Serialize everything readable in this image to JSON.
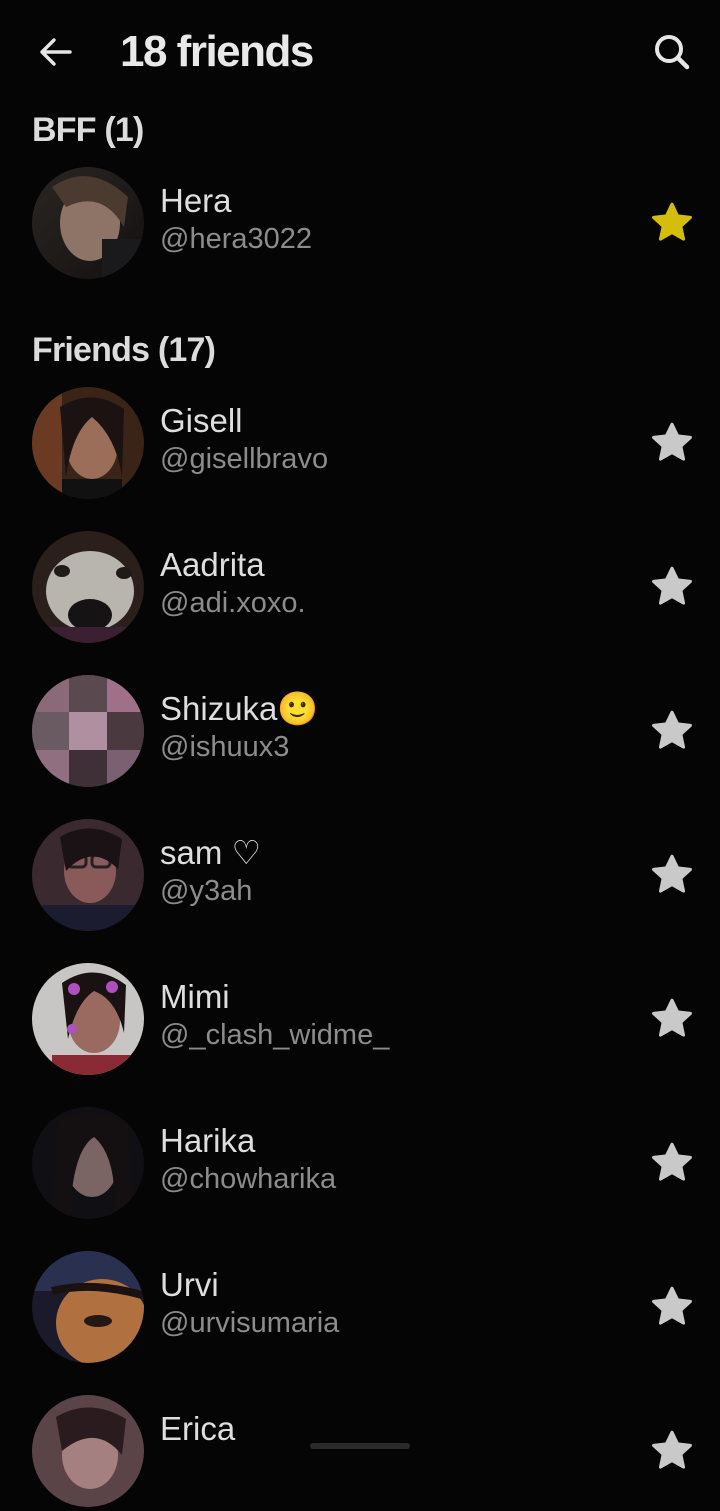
{
  "header": {
    "back_icon": "arrow-left-icon",
    "title": "18 friends",
    "search_icon": "search-icon"
  },
  "colors": {
    "background": "#050505",
    "star_active": "#d4bd0c",
    "star_inactive": "#c9c9c9",
    "text_primary": "#dedede",
    "text_secondary": "#8c8c8c"
  },
  "bff": {
    "title": "BFF (1)",
    "items": [
      {
        "name": "Hera",
        "handle": "@hera3022",
        "starred": true
      }
    ]
  },
  "friends": {
    "title": "Friends (17)",
    "items": [
      {
        "name": "Gisell",
        "handle": "@gisellbravo",
        "starred": false
      },
      {
        "name": "Aadrita",
        "handle": "@adi.xoxo.",
        "starred": false
      },
      {
        "name": "Shizuka🙂",
        "handle": "@ishuux3",
        "starred": false
      },
      {
        "name": "sam ♡",
        "handle": "@y3ah",
        "starred": false
      },
      {
        "name": "Mimi",
        "handle": "@_clash_widme_",
        "starred": false
      },
      {
        "name": "Harika",
        "handle": "@chowharika",
        "starred": false
      },
      {
        "name": "Urvi",
        "handle": "@urvisumaria",
        "starred": false
      },
      {
        "name": "Erica",
        "handle": "",
        "starred": false
      }
    ]
  }
}
